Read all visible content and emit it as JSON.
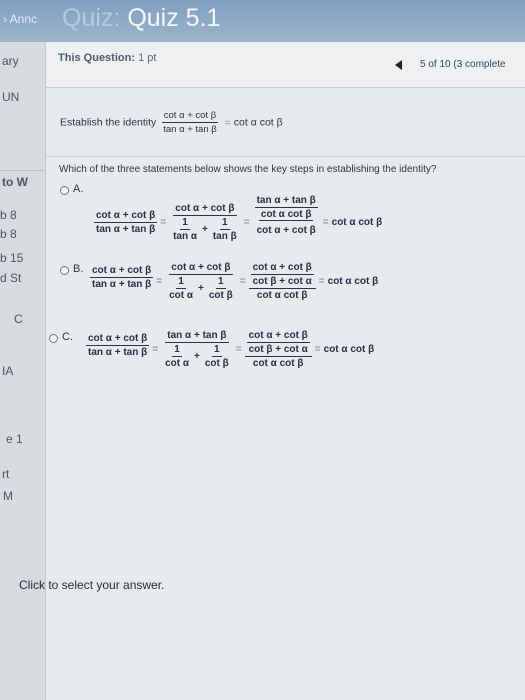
{
  "header": {
    "crumb": "› Annc",
    "title_prefix": "Quiz:",
    "title": "Quiz 5.1"
  },
  "left_strip": {
    "ary": "ary",
    "un": "UN",
    "to_w": "to W",
    "b8a": "b 8",
    "b8b": "b 8",
    "b15": "b 15",
    "dst": "d St",
    "c": "C",
    "ia": "IA",
    "hl": "e 1",
    "rt": "rt",
    "m": "M"
  },
  "infobar": {
    "this_question_label": "This Question:",
    "points": "1 pt",
    "progress": "5 of 10 (3 complete"
  },
  "question": {
    "establish_text": "Establish the identity",
    "ask": "Which of the three statements below shows the key steps in establishing the identity?",
    "identity": {
      "num": "cot α + cot β",
      "den": "tan α + tan β",
      "rhs": "cot α cot β"
    }
  },
  "options": [
    {
      "letter": "A.",
      "lhs_num": "cot α + cot β",
      "lhs_den": "tan α + tan β",
      "s2_num": "cot α + cot β",
      "s2_d1": "1",
      "s2_d1den": "tan α",
      "s2_d2": "1",
      "s2_d2den": "tan β",
      "s3_top": "tan α + tan β",
      "s3_mid": "cot α cot β",
      "s3_bot": "cot α + cot β",
      "result": "cot α cot β"
    },
    {
      "letter": "B.",
      "lhs_num": "cot α + cot β",
      "lhs_den": "tan α + tan β",
      "s2_num": "cot α + cot β",
      "s2_d1": "1",
      "s2_d1den": "cot α",
      "s2_d2": "1",
      "s2_d2den": "cot β",
      "s3_top": "cot α + cot β",
      "s3_mid": "cot β + cot α",
      "s3_bot": "cot α cot β",
      "result": "cot α cot β"
    },
    {
      "letter": "C.",
      "lhs_num": "cot α + cot β",
      "lhs_den": "tan α + tan β",
      "s2_num": "tan α + tan β",
      "s2_d1": "1",
      "s2_d1den": "cot α",
      "s2_d2": "1",
      "s2_d2den": "cot β",
      "s3_top": "cot α + cot β",
      "s3_mid": "cot β + cot α",
      "s3_bot": "cot α cot β",
      "result": "cot α cot β"
    }
  ],
  "footer": {
    "hint": "Click to select your answer."
  }
}
